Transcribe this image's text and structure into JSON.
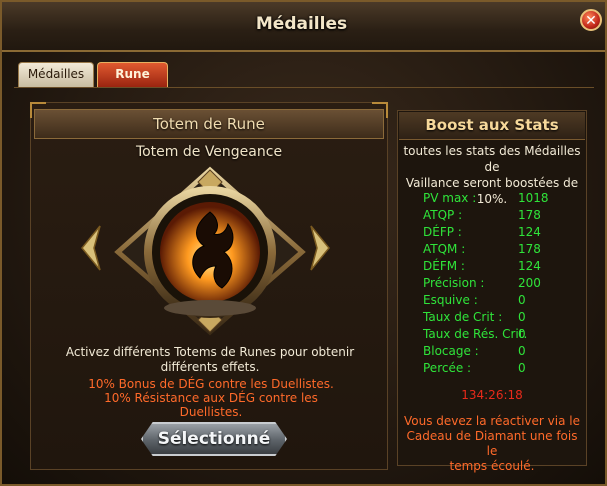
{
  "window": {
    "title": "Médailles",
    "close_icon": "close-icon"
  },
  "tabs": [
    {
      "label": "Médailles",
      "active": false
    },
    {
      "label": "Rune",
      "active": true
    }
  ],
  "left": {
    "header": "Totem de Rune",
    "totem_name": "Totem de Vengeance",
    "emblem_icon": "fire-rune-icon",
    "description_line1": "Activez différents Totems de Runes pour obtenir",
    "description_line2": "différents effets.",
    "bonus_line1": "10% Bonus de DÉG contre les Duellistes.",
    "bonus_line2": "10% Résistance aux DÉG contre les",
    "bonus_line3": "Duellistes.",
    "select_button": "Sélectionné"
  },
  "right": {
    "header": "Boost aux Stats",
    "desc_line1": "toutes les stats des Médailles de",
    "desc_line2": "Vaillance seront boostées de",
    "desc_line3": "10%.",
    "stats": [
      {
        "label": "PV max :",
        "value": "1018"
      },
      {
        "label": "ATQP :",
        "value": "178"
      },
      {
        "label": "DÉFP :",
        "value": "124"
      },
      {
        "label": "ATQM :",
        "value": "178"
      },
      {
        "label": "DÉFM :",
        "value": "124"
      },
      {
        "label": "Précision :",
        "value": "200"
      },
      {
        "label": "Esquive :",
        "value": "0"
      },
      {
        "label": "Taux de Crit :",
        "value": "0"
      },
      {
        "label": "Taux de Rés. Crit.",
        "value": "0"
      },
      {
        "label": "Blocage :",
        "value": "0"
      },
      {
        "label": "Percée :",
        "value": "0"
      }
    ],
    "timer": "134:26:18",
    "notice_line1": "Vous devez la réactiver via le",
    "notice_line2": "Cadeau de Diamant une fois le",
    "notice_line3": "temps écoulé."
  },
  "colors": {
    "accent": "#ff6a2a",
    "stat_green": "#2fe43a",
    "timer_red": "#e82a1a"
  }
}
